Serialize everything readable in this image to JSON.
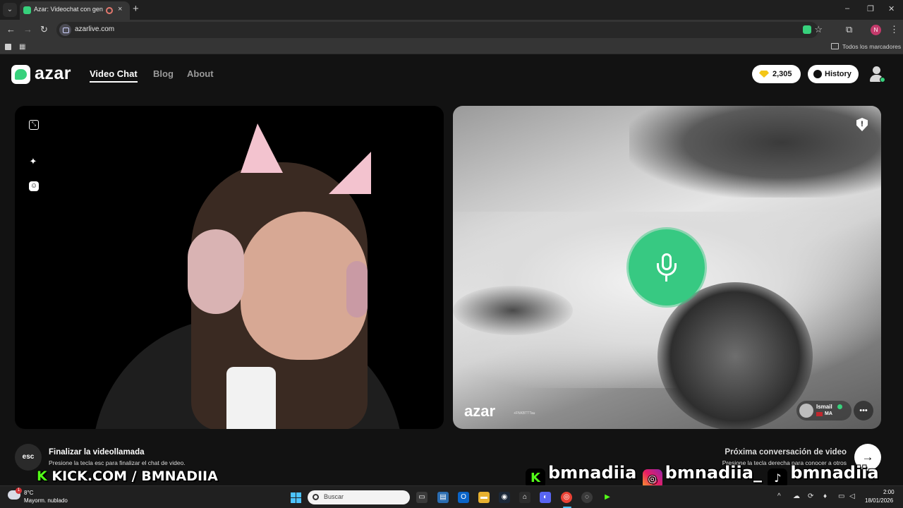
{
  "browser": {
    "tab_title": "Azar: Videochat con gente",
    "new_tab": "+",
    "tab_close": "×",
    "url": "azarlive.com",
    "bookmarks_all": "Todos los marcadores",
    "profile_initial": "N",
    "window_controls": [
      "–",
      "❐",
      "✕"
    ]
  },
  "header": {
    "logo": "azar",
    "nav": [
      "Video Chat",
      "Blog",
      "About"
    ],
    "active_nav": "Video Chat",
    "gems": "2,305",
    "history_label": "History"
  },
  "remote_video": {
    "watermark": "azar",
    "watermark_id": "+FNKBTTTau",
    "partner_name": "Ismail",
    "partner_country": "MA"
  },
  "footer": {
    "esc_key": "esc",
    "end_title": "Finalizar la videollamada",
    "end_sub": "Presione la tecla esc para finalizar el chat de video.",
    "next_title": "Próxima conversación de video",
    "next_sub": "Presione la tecla derecha para conocer a otros",
    "next_arrow": "→"
  },
  "stream_overlay": {
    "kick_url": "KICK.COM / BMNADIIA",
    "handle_kick": "bmnadiia",
    "handle_instagram": "bmnadiia_",
    "handle_tiktok": "bmnadiia"
  },
  "taskbar": {
    "weather_temp": "8°C",
    "weather_cond": "Mayorm. nublado",
    "weather_badge": "1",
    "search_placeholder": "Buscar",
    "time": "2:00",
    "date": "18/01/2026"
  },
  "colors": {
    "brand_green": "#37d17c",
    "mic_green": "#37c982",
    "kick_green": "#53fc18",
    "gem_gold": "#f4c617"
  }
}
